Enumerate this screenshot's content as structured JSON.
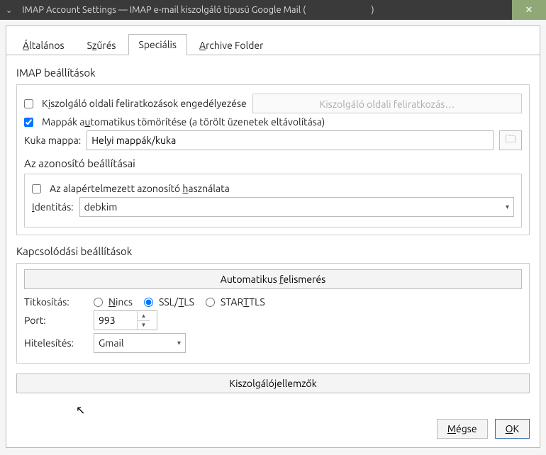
{
  "window": {
    "title": "IMAP Account Settings — IMAP e-mail kiszolgáló típusú Google Mail (",
    "title_suffix": ")",
    "close_icon": "✕"
  },
  "tabs": {
    "general": "Általános",
    "general_u": "Á",
    "filter": "Szűrés",
    "filter_pre": "S",
    "filter_u": "z",
    "filter_post": "űrés",
    "special": "Speciális",
    "archive": "Archive Folder",
    "archive_u": "A",
    "archive_post": "rchive Folder"
  },
  "imap": {
    "heading": "IMAP beállítások",
    "server_sub_pre": "K",
    "server_sub_u": "i",
    "server_sub_post": "szolgáló oldali feliratkozások engedélyezése",
    "server_sub_btn": "Kiszolgáló oldali feliratkozás…",
    "auto_compact_pre": "Mappák a",
    "auto_compact_u": "u",
    "auto_compact_post": "tomatikus tömörítése (a törölt üzenetek eltávolítása)",
    "trash_label": "Kuka mappa:",
    "trash_value": "Helyi mappák/kuka",
    "folder_icon": "🗀"
  },
  "ident": {
    "heading": "Az azonosító beállításai",
    "use_default_pre": "Az alapértelmezett azonosító ",
    "use_default_u": "h",
    "use_default_post": "asználata",
    "identity_label_u": "I",
    "identity_label_post": "dentitás:",
    "identity_value": "debkim"
  },
  "conn": {
    "heading": "Kapcsolódási beállítások",
    "autodetect_pre": "Automatikus ",
    "autodetect_u": "f",
    "autodetect_post": "elismerés",
    "encryption_label": "Titkosítás:",
    "none_u": "N",
    "none_post": "incs",
    "ssl_pre": "SSL/",
    "ssl_u": "T",
    "ssl_post": "LS",
    "starttls_pre": "STAR",
    "starttls_u": "T",
    "starttls_post": "TLS",
    "port_label": "Port:",
    "port_value": "993",
    "auth_label": "Hitelesítés:",
    "auth_value": "Gmail",
    "serverfeat": "Kiszolgálójellemzők"
  },
  "footer": {
    "cancel_u": "M",
    "cancel_post": "égse",
    "ok_u": "O",
    "ok_post": "K"
  }
}
